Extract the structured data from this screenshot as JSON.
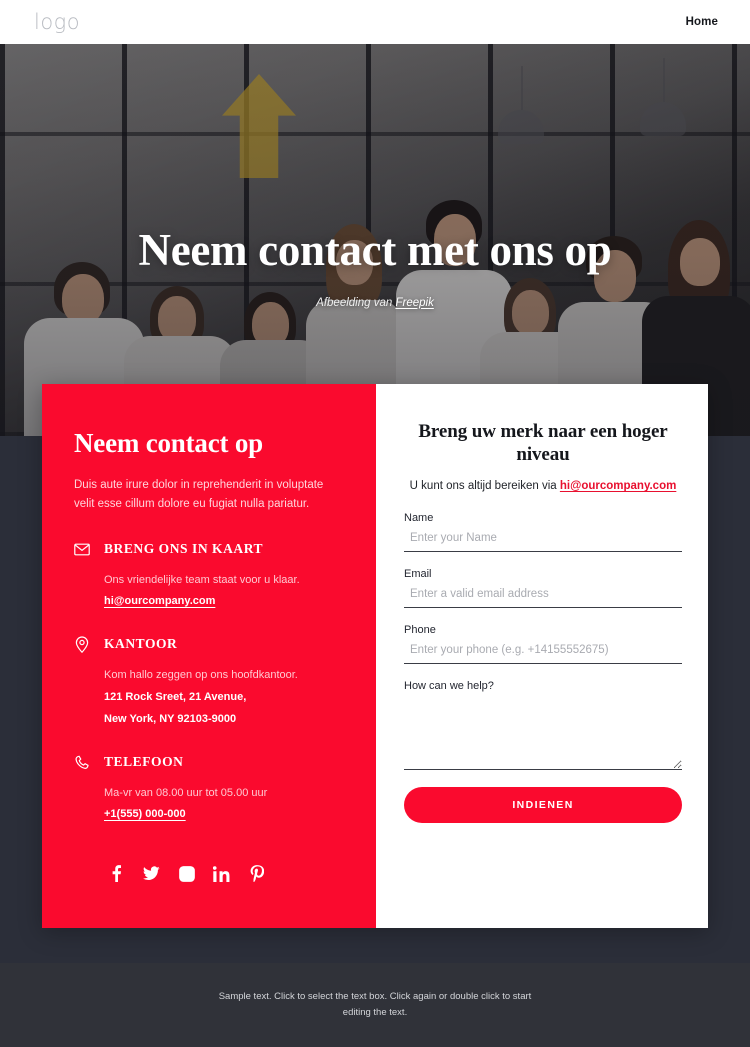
{
  "header": {
    "logo": "logo",
    "nav": [
      {
        "label": "Home",
        "icon": "home-nav-item"
      }
    ]
  },
  "hero": {
    "title": "Neem contact met ons op",
    "caption_prefix": "Afbeelding van ",
    "caption_link": "Freepik"
  },
  "contact_card": {
    "heading": "Neem contact op",
    "lede": "Duis aute irure dolor in reprehenderit in voluptate velit esse cillum dolore eu fugiat nulla pariatur.",
    "blocks": [
      {
        "icon": "envelope-icon",
        "title": "BRENG ONS IN KAART",
        "desc": "Ons vriendelijke team staat voor u klaar.",
        "link": "hi@ourcompany.com"
      },
      {
        "icon": "map-pin-icon",
        "title": "KANTOOR",
        "desc": "Kom hallo zeggen op ons hoofdkantoor.",
        "line1": "121 Rock Sreet, 21 Avenue,",
        "line2": "New York, NY 92103-9000"
      },
      {
        "icon": "phone-icon",
        "title": "TELEFOON",
        "desc": "Ma-vr van 08.00 uur tot 05.00 uur",
        "link": "+1(555) 000-000"
      }
    ],
    "socials": [
      {
        "icon": "facebook-icon",
        "label": "Facebook"
      },
      {
        "icon": "twitter-icon",
        "label": "Twitter"
      },
      {
        "icon": "instagram-icon",
        "label": "Instagram"
      },
      {
        "icon": "linkedin-icon",
        "label": "LinkedIn"
      },
      {
        "icon": "pinterest-icon",
        "label": "Pinterest"
      }
    ]
  },
  "form": {
    "title": "Breng uw merk naar een hoger niveau",
    "sub_prefix": "U kunt ons altijd bereiken via ",
    "sub_email": "hi@ourcompany.com",
    "fields": {
      "name": {
        "label": "Name",
        "placeholder": "Enter your Name",
        "value": ""
      },
      "email": {
        "label": "Email",
        "placeholder": "Enter a valid email address",
        "value": ""
      },
      "phone": {
        "label": "Phone",
        "placeholder": "Enter your phone (e.g. +14155552675)",
        "value": ""
      },
      "message": {
        "label": "How can we help?",
        "placeholder": "",
        "value": ""
      }
    },
    "submit_label": "INDIENEN"
  },
  "footer": {
    "text": "Sample text. Click to select the text box. Click again or double click to start editing the text."
  },
  "colors": {
    "accent_red": "#fa0a2e",
    "link_red": "#e8102f",
    "dark_bg": "#2b2e39",
    "footer_bg": "#303239"
  }
}
